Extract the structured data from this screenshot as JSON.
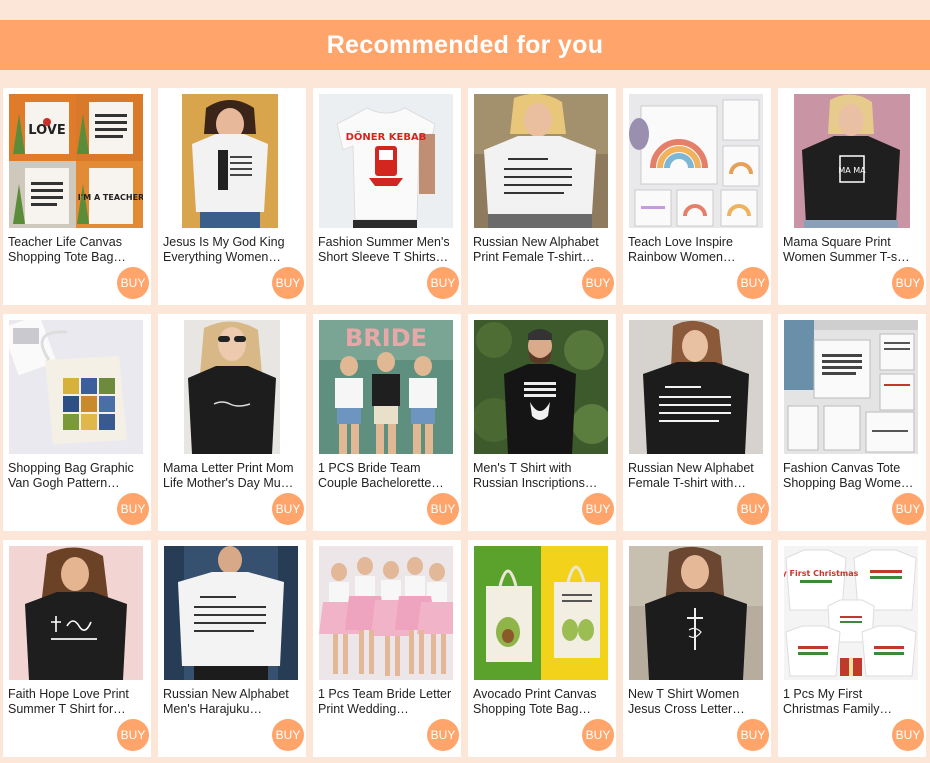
{
  "header": {
    "title": "Recommended for you"
  },
  "buy_label": "BUY",
  "products": [
    {
      "title": "Teacher Life Canvas Shopping Tote Bag…",
      "image": "tote-bags-teacher"
    },
    {
      "title": "Jesus Is My God King Everything Women…",
      "image": "white-tshirt-woman"
    },
    {
      "title": "Fashion Summer Men's Short Sleeve T Shirts…",
      "image": "doner-kebab-tshirt"
    },
    {
      "title": "Russian New Alphabet Print Female T-shirt…",
      "image": "alphabet-white-tshirt"
    },
    {
      "title": "Teach Love Inspire Rainbow Women…",
      "image": "rainbow-tote-bags"
    },
    {
      "title": "Mama Square Print Women Summer T-s…",
      "image": "mama-black-tshirt"
    },
    {
      "title": "Shopping Bag Graphic Van Gogh Pattern…",
      "image": "van-gogh-tote"
    },
    {
      "title": "Mama Letter Print Mom Life Mother's Day Mu…",
      "image": "black-tshirt-sunglasses"
    },
    {
      "title": "1 PCS Bride Team Couple Bachelorette…",
      "image": "bride-team-group"
    },
    {
      "title": "Men's T Shirt with Russian Inscriptions…",
      "image": "beard-man-tshirt"
    },
    {
      "title": "Russian New Alphabet Female T-shirt with…",
      "image": "alphabet-black-tshirt"
    },
    {
      "title": "Fashion Canvas Tote Shopping Bag Wome…",
      "image": "quote-tote-bags"
    },
    {
      "title": "Faith Hope Love Print Summer T Shirt for…",
      "image": "faith-hope-love-tshirt"
    },
    {
      "title": "Russian New Alphabet Men's Harajuku…",
      "image": "alphabet-men-tshirt"
    },
    {
      "title": "1 Pcs Team Bride Letter Print Wedding…",
      "image": "team-bride-pink"
    },
    {
      "title": "Avocado Print Canvas Shopping Tote Bag…",
      "image": "avocado-tote"
    },
    {
      "title": "New T Shirt Women Jesus Cross Letter…",
      "image": "jesus-cross-tshirt"
    },
    {
      "title": "1 Pcs My First Christmas Family…",
      "image": "christmas-family-tshirts"
    }
  ],
  "image_text": {
    "love": "LOVE",
    "teacher": "I'M A TEACHER",
    "doner": "DÖNER KEBAB",
    "mama": "MA MA",
    "bride": "BRIDE",
    "christmas": "My First Christmas"
  }
}
